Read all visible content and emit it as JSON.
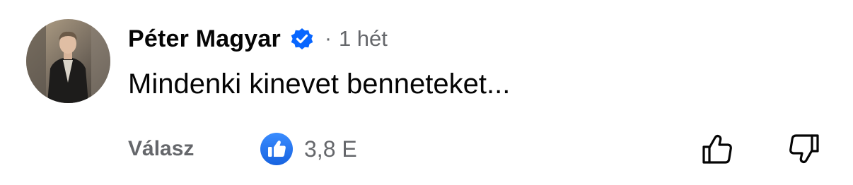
{
  "comment": {
    "author": "Péter Magyar",
    "verified_icon": "verified-badge-icon",
    "separator": "·",
    "time_ago": "1 hét",
    "text": "Mindenki kinevet benneteket...",
    "reply_label": "Válasz",
    "reaction_icon": "thumbs-up-icon",
    "reaction_count": "3,8 E",
    "upvote_icon": "thumbs-up-outline-icon",
    "downvote_icon": "thumbs-down-outline-icon"
  },
  "colors": {
    "primary_text": "#050505",
    "secondary_text": "#65676b",
    "accent_blue": "#1877f2",
    "verified_blue": "#0866ff"
  }
}
